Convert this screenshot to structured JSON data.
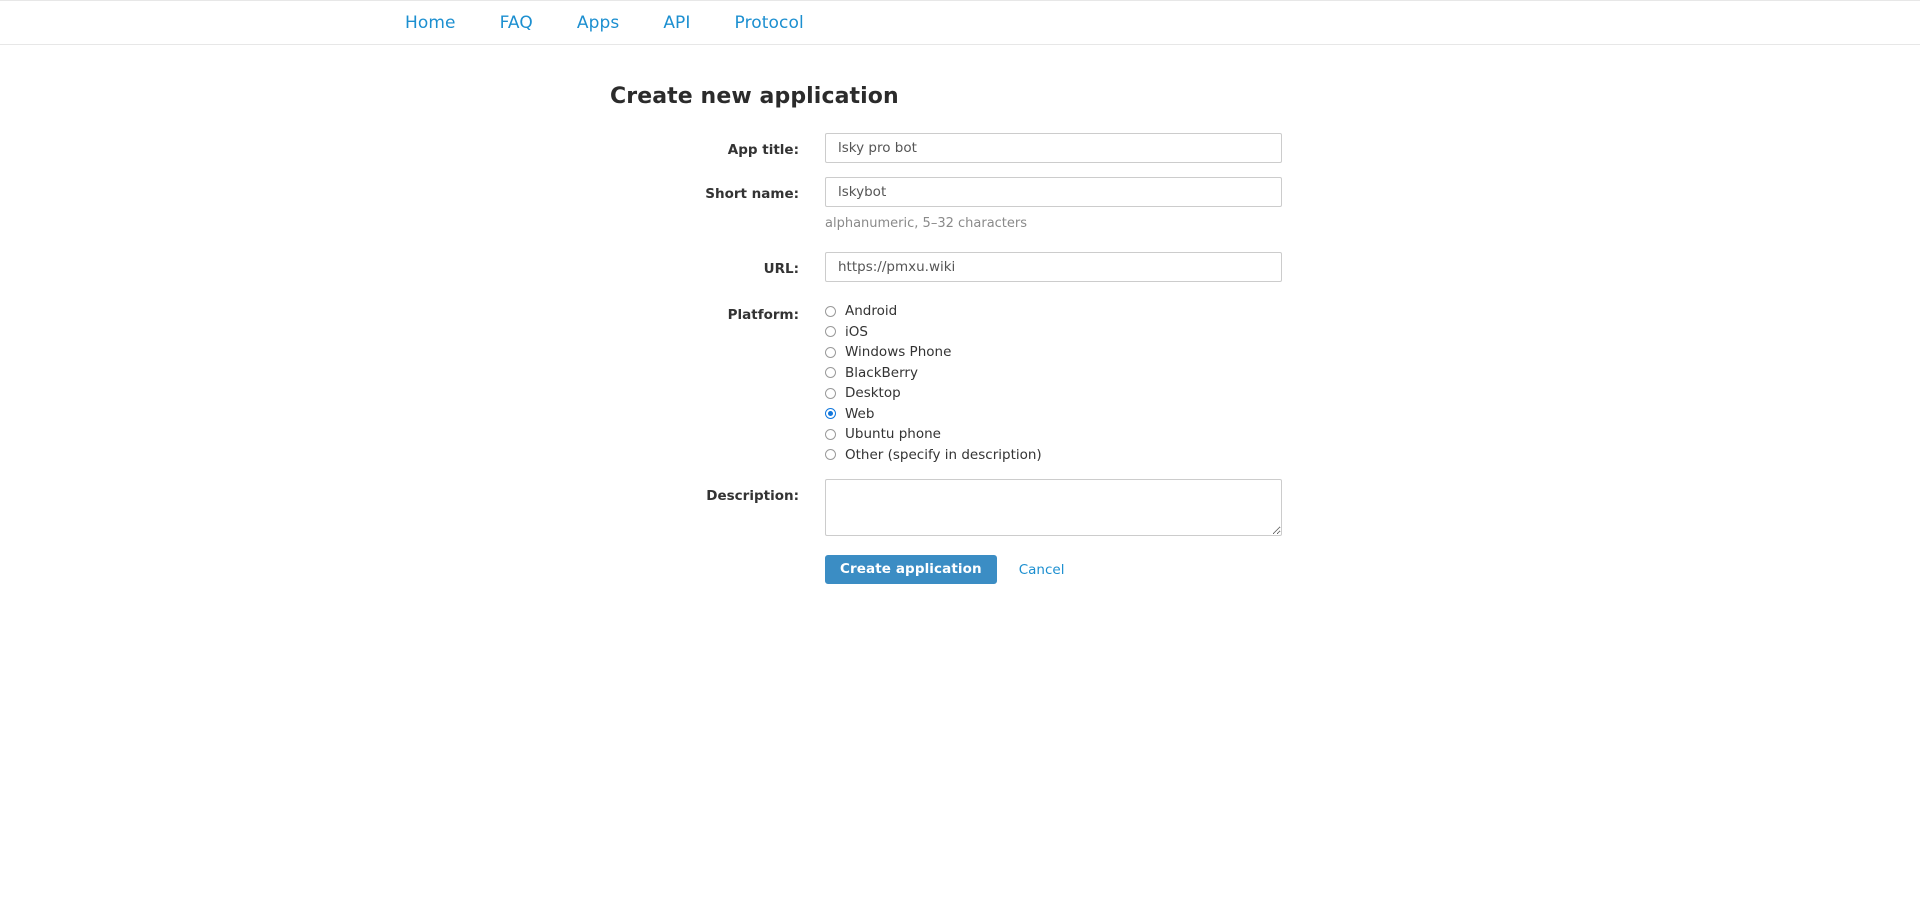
{
  "nav": {
    "items": [
      {
        "label": "Home",
        "name": "nav-link-home"
      },
      {
        "label": "FAQ",
        "name": "nav-link-faq"
      },
      {
        "label": "Apps",
        "name": "nav-link-apps"
      },
      {
        "label": "API",
        "name": "nav-link-api"
      },
      {
        "label": "Protocol",
        "name": "nav-link-protocol"
      }
    ]
  },
  "page": {
    "title": "Create new application"
  },
  "form": {
    "app_title": {
      "label": "App title:",
      "value": "lsky pro bot",
      "placeholder": ""
    },
    "short_name": {
      "label": "Short name:",
      "value": "lskybot",
      "placeholder": "",
      "help": "alphanumeric, 5–32 characters"
    },
    "url": {
      "label": "URL:",
      "value": "https://pmxu.wiki",
      "placeholder": ""
    },
    "platform": {
      "label": "Platform:",
      "selected": "Web",
      "options": [
        "Android",
        "iOS",
        "Windows Phone",
        "BlackBerry",
        "Desktop",
        "Web",
        "Ubuntu phone",
        "Other (specify in description)"
      ]
    },
    "description": {
      "label": "Description:",
      "value": "",
      "placeholder": ""
    }
  },
  "actions": {
    "submit_label": "Create application",
    "cancel_label": "Cancel"
  },
  "colors": {
    "link": "#1c8fd0",
    "primary_button": "#3b8dc4",
    "radio_selected": "#1177dd",
    "border": "#cccccc",
    "help_text": "#8a8a8a"
  }
}
